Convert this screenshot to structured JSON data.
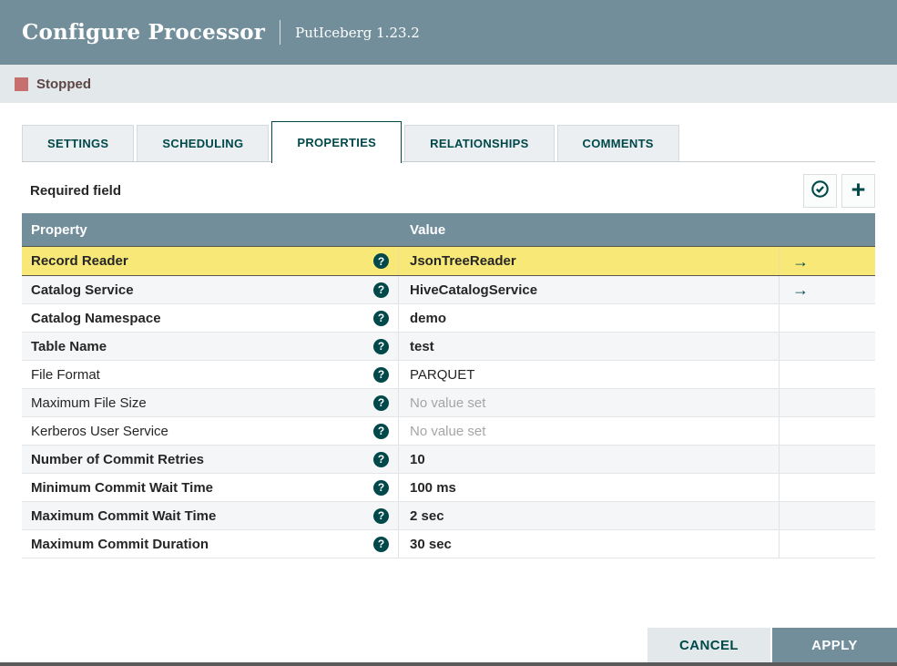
{
  "header": {
    "title": "Configure Processor",
    "subtitle": "PutIceberg 1.23.2"
  },
  "status_bar": {
    "label": "Stopped"
  },
  "tabs": [
    {
      "label": "SETTINGS",
      "active": false
    },
    {
      "label": "SCHEDULING",
      "active": false
    },
    {
      "label": "PROPERTIES",
      "active": true
    },
    {
      "label": "RELATIONSHIPS",
      "active": false
    },
    {
      "label": "COMMENTS",
      "active": false
    }
  ],
  "properties_panel": {
    "required_field_label": "Required field",
    "toolbar": {
      "verify_button_icon": "check-circle-icon",
      "add_button_icon": "plus-icon"
    },
    "table": {
      "columns": [
        "Property",
        "Value"
      ],
      "rows": [
        {
          "property": "Record Reader",
          "value": "JsonTreeReader",
          "bold": true,
          "selected": true,
          "goto": true,
          "no_value": false
        },
        {
          "property": "Catalog Service",
          "value": "HiveCatalogService",
          "bold": true,
          "selected": false,
          "goto": true,
          "no_value": false
        },
        {
          "property": "Catalog Namespace",
          "value": "demo",
          "bold": true,
          "selected": false,
          "goto": false,
          "no_value": false
        },
        {
          "property": "Table Name",
          "value": "test",
          "bold": true,
          "selected": false,
          "goto": false,
          "no_value": false
        },
        {
          "property": "File Format",
          "value": "PARQUET",
          "bold": false,
          "selected": false,
          "goto": false,
          "no_value": false
        },
        {
          "property": "Maximum File Size",
          "value": "No value set",
          "bold": false,
          "selected": false,
          "goto": false,
          "no_value": true
        },
        {
          "property": "Kerberos User Service",
          "value": "No value set",
          "bold": false,
          "selected": false,
          "goto": false,
          "no_value": true
        },
        {
          "property": "Number of Commit Retries",
          "value": "10",
          "bold": true,
          "selected": false,
          "goto": false,
          "no_value": false
        },
        {
          "property": "Minimum Commit Wait Time",
          "value": "100 ms",
          "bold": true,
          "selected": false,
          "goto": false,
          "no_value": false
        },
        {
          "property": "Maximum Commit Wait Time",
          "value": "2 sec",
          "bold": true,
          "selected": false,
          "goto": false,
          "no_value": false
        },
        {
          "property": "Maximum Commit Duration",
          "value": "30 sec",
          "bold": true,
          "selected": false,
          "goto": false,
          "no_value": false
        }
      ]
    }
  },
  "footer": {
    "cancel_label": "CANCEL",
    "apply_label": "APPLY"
  },
  "icons": {
    "help": "?",
    "goto": "→",
    "plus": "+"
  },
  "colors": {
    "accent_teal": "#004849",
    "header_slate": "#728e9b",
    "selected_row_yellow": "#f7e878",
    "stopped_red": "#c76f6f",
    "status_bar_bg": "#e3e8eb"
  }
}
